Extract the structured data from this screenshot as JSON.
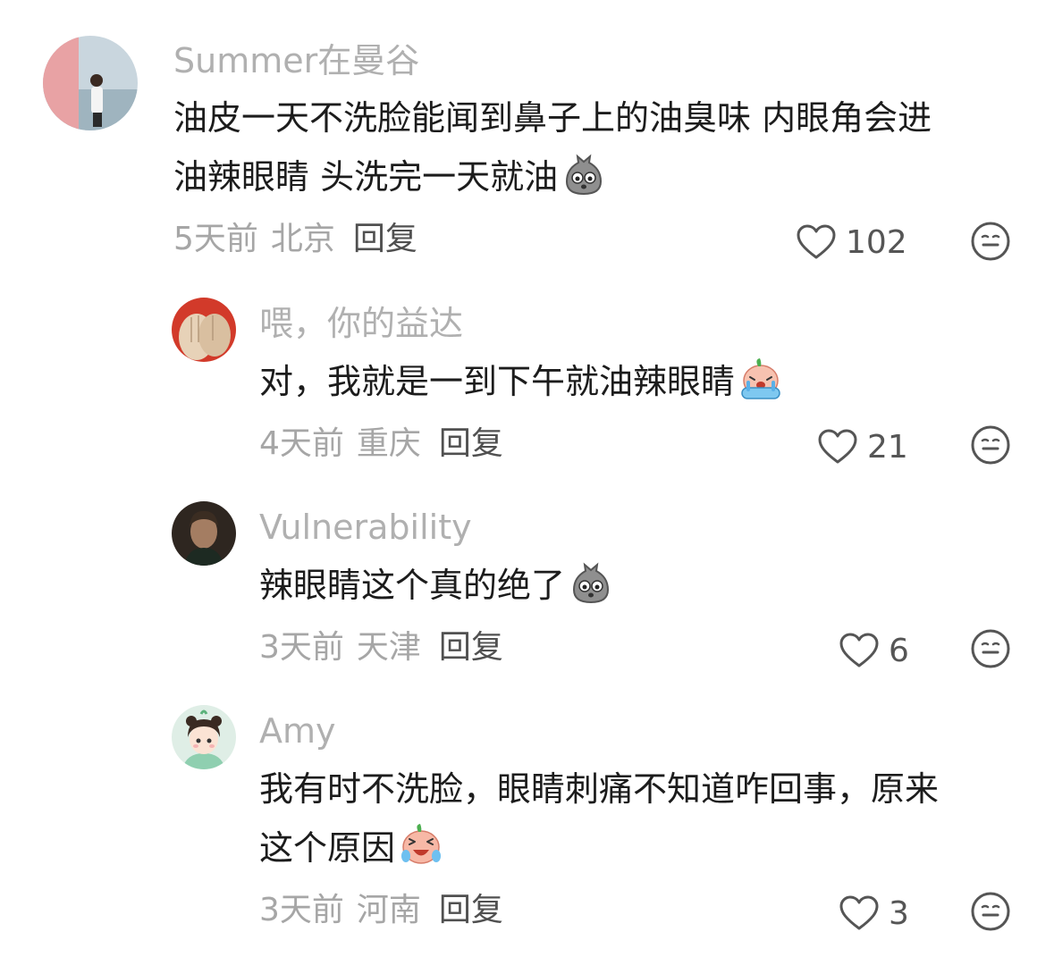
{
  "comments": [
    {
      "username": "Summer在曼谷",
      "lines": [
        "油皮一天不洗脸能闻到鼻子上的油臭味 内眼角会进",
        "油辣眼睛 头洗完一天就油"
      ],
      "emoji": "sack-face-emoji",
      "time": "5天前",
      "location": "北京",
      "reply": "回复",
      "likes": "102"
    },
    {
      "username": "喂，你的益达",
      "lines": [
        "对，我就是一到下午就油辣眼睛"
      ],
      "emoji": "crying-peach-emoji",
      "time": "4天前",
      "location": "重庆",
      "reply": "回复",
      "likes": "21"
    },
    {
      "username": "Vulnerability",
      "lines": [
        "辣眼睛这个真的绝了"
      ],
      "emoji": "sack-face-emoji",
      "time": "3天前",
      "location": "天津",
      "reply": "回复",
      "likes": "6"
    },
    {
      "username": "Amy",
      "lines": [
        "我有时不洗脸，眼睛刺痛不知道咋回事，原来",
        "这个原因"
      ],
      "emoji": "laughing-tears-peach-emoji",
      "time": "3天前",
      "location": "河南",
      "reply": "回复",
      "likes": "3"
    }
  ],
  "colors": {
    "username": "#b0b0b0",
    "body": "#1c1c1c",
    "meta": "#a6a6a6",
    "reply": "#505050",
    "icon": "#555555"
  }
}
